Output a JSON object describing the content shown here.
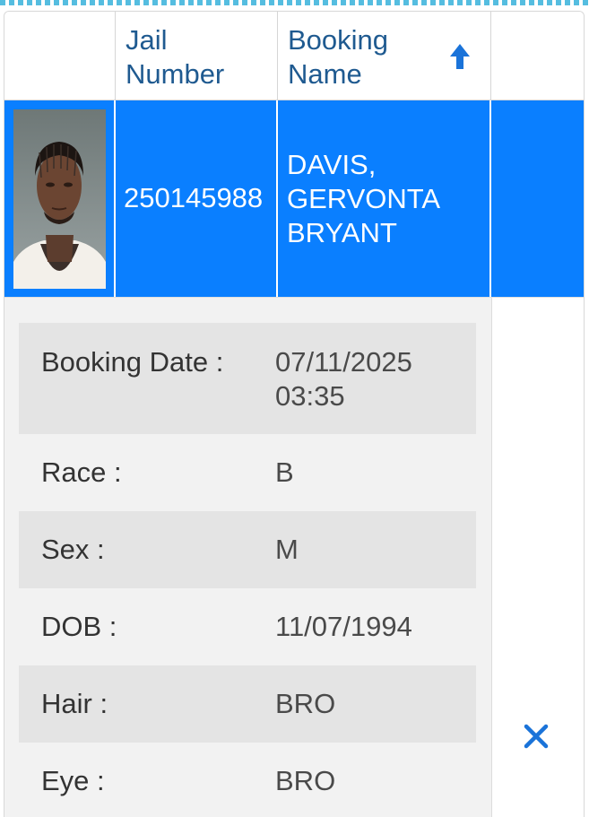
{
  "header": {
    "jail_number_label": "Jail Number",
    "booking_name_label": "Booking Name",
    "sort_icon": "arrow-up-icon"
  },
  "record": {
    "photo": "mugshot-photo",
    "jail_number": "250145988",
    "booking_name": "DAVIS, GERVONTA BRYANT"
  },
  "details": [
    {
      "label": "Booking Date :",
      "value": "07/11/2025 03:35"
    },
    {
      "label": "Race :",
      "value": "B"
    },
    {
      "label": "Sex :",
      "value": "M"
    },
    {
      "label": "DOB :",
      "value": "11/07/1994"
    },
    {
      "label": "Hair :",
      "value": "BRO"
    },
    {
      "label": "Eye :",
      "value": "BRO"
    }
  ],
  "close_icon": "close-x-icon",
  "colors": {
    "accent": "#0a7fff",
    "header_text": "#1f5a90",
    "icon": "#1a73d9",
    "dash": "#55bde0"
  }
}
